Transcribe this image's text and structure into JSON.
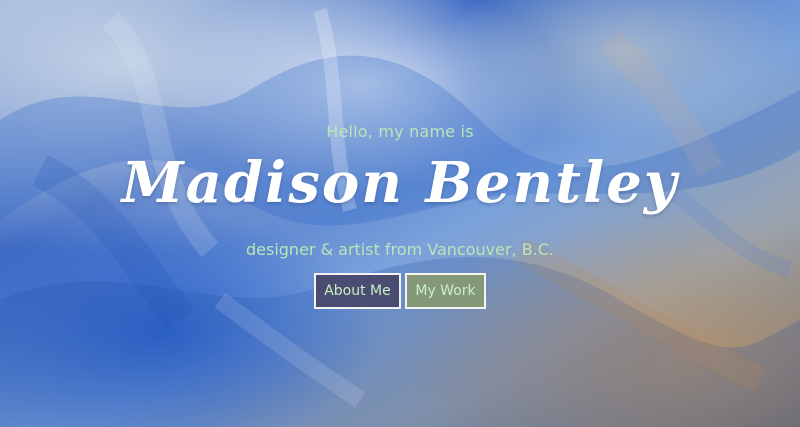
{
  "hero": {
    "intro": "Hello, my name is",
    "name": "Madison Bentley",
    "tagline": "designer & artist from Vancouver, B.C."
  },
  "nav": {
    "about_label": "About Me",
    "work_label": "My Work"
  },
  "colors": {
    "accent_text": "#b9e6b8",
    "about_button_bg": "#4b4c72",
    "work_button_bg": "#859877",
    "button_border": "#f3f3f3"
  },
  "background": {
    "icon": "abstract-blue-painting"
  }
}
